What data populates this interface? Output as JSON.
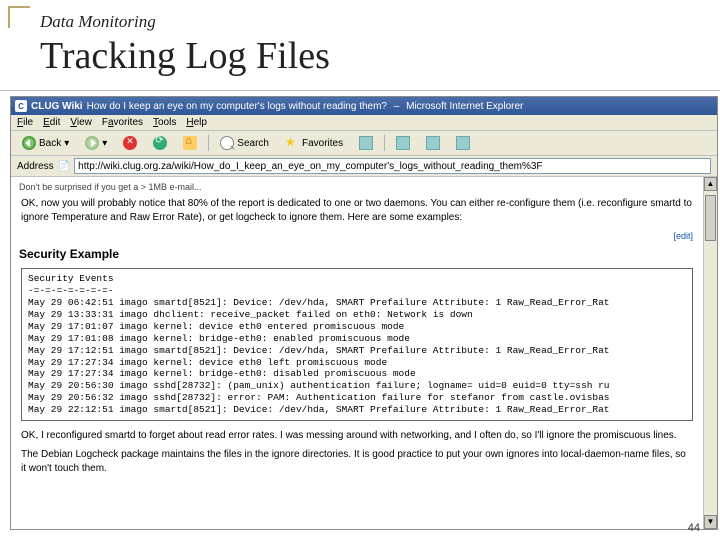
{
  "slide": {
    "subtitle": "Data Monitoring",
    "title": "Tracking Log Files",
    "page_number": "44"
  },
  "browser": {
    "window_title_prefix": "CLUG Wiki",
    "window_title": "How do I keep an eye on my computer's logs without reading them?",
    "window_title_app": "Microsoft Internet Explorer",
    "menu": {
      "file": "File",
      "edit": "Edit",
      "view": "View",
      "favorites": "Favorites",
      "tools": "Tools",
      "help": "Help"
    },
    "toolbar": {
      "back": "Back",
      "search": "Search",
      "favorites": "Favorites"
    },
    "address_label": "Address",
    "address_value": "http://wiki.clug.org.za/wiki/How_do_I_keep_an_eye_on_my_computer's_logs_without_reading_them%3F"
  },
  "page": {
    "truncated_top": "Don't be surprised if you get a > 1MB e-mail...",
    "intro": "OK, now you will probably notice that 80% of the report is dedicated to one or two daemons. You can either re-configure them (i.e. reconfigure smartd to ignore Temperature and Raw Error Rate), or get logcheck to ignore them. Here are some examples:",
    "edit": "[edit]",
    "section_heading": "Security Example",
    "log_text": "Security Events\n-=-=-=-=-=-=-=-\nMay 29 06:42:51 imago smartd[8521]: Device: /dev/hda, SMART Prefailure Attribute: 1 Raw_Read_Error_Rat\nMay 29 13:33:31 imago dhclient: receive_packet failed on eth0: Network is down\nMay 29 17:01:07 imago kernel: device eth0 entered promiscuous mode\nMay 29 17:01:08 imago kernel: bridge-eth0: enabled promiscuous mode\nMay 29 17:12:51 imago smartd[8521]: Device: /dev/hda, SMART Prefailure Attribute: 1 Raw_Read_Error_Rat\nMay 29 17:27:34 imago kernel: device eth0 left promiscuous mode\nMay 29 17:27:34 imago kernel: bridge-eth0: disabled promiscuous mode\nMay 29 20:56:30 imago sshd[28732]: (pam_unix) authentication failure; logname= uid=0 euid=0 tty=ssh ru\nMay 29 20:56:32 imago sshd[28732]: error: PAM: Authentication failure for stefanor from castle.ovisbas\nMay 29 22:12:51 imago smartd[8521]: Device: /dev/hda, SMART Prefailure Attribute: 1 Raw_Read_Error_Rat",
    "outro1": "OK, I reconfigured smartd to forget about read error rates. I was messing around with networking, and I often do, so I'll ignore the promiscuous lines.",
    "outro2": "The Debian Logcheck package maintains the files in the ignore directories. It is good practice to put your own ignores into local-daemon-name files, so it won't touch them."
  }
}
